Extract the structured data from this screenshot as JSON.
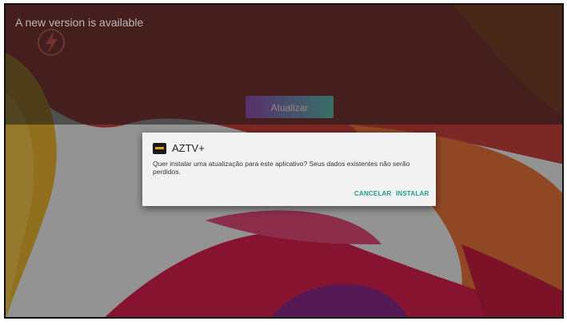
{
  "background": {
    "update_title": "A new version is available",
    "update_button_label": "Atualizar"
  },
  "dialog": {
    "app_name": "AZTV+",
    "message": "Quer instalar uma atualização para este aplicativo? Seus dados existentes não serão perdidos.",
    "cancel_label": "CANCELAR",
    "install_label": "INSTALAR"
  },
  "colors": {
    "accent": "#1e9c8c",
    "dialog_bg": "#f2f2f2"
  }
}
